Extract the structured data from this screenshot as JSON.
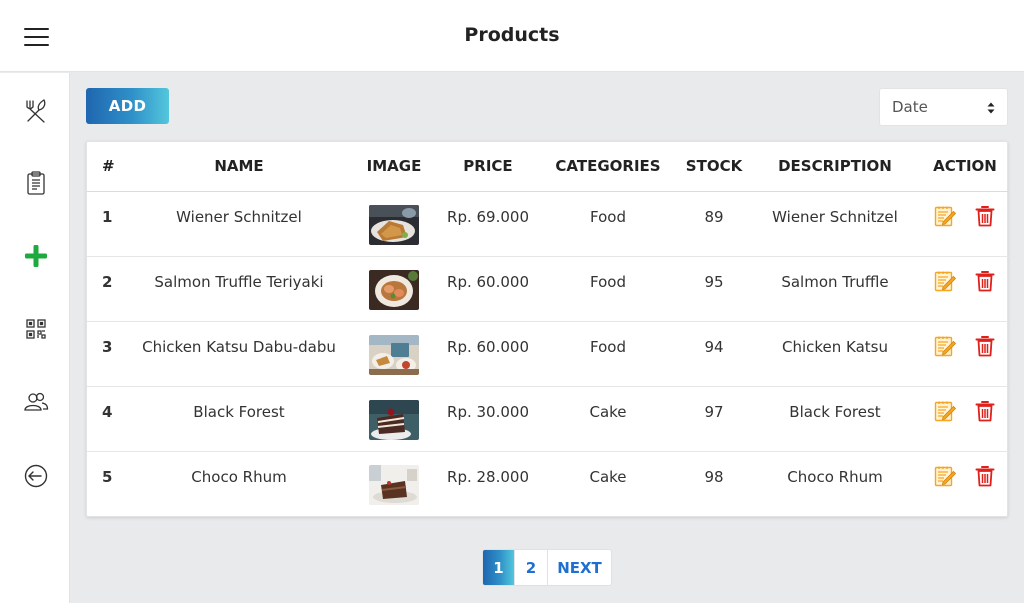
{
  "header": {
    "title": "Products"
  },
  "sidebar": {
    "items": [
      {
        "name": "food-menu-icon"
      },
      {
        "name": "clipboard-icon"
      },
      {
        "name": "add-icon",
        "color": "#1eaa3c"
      },
      {
        "name": "qr-code-icon"
      },
      {
        "name": "users-icon"
      },
      {
        "name": "logout-icon"
      }
    ]
  },
  "toolbar": {
    "add_label": "ADD",
    "sort_value": "Date"
  },
  "table": {
    "columns": [
      "#",
      "NAME",
      "IMAGE",
      "PRICE",
      "CATEGORIES",
      "STOCK",
      "DESCRIPTION",
      "ACTION"
    ],
    "rows": [
      {
        "no": "1",
        "name": "Wiener Schnitzel",
        "price": "Rp. 69.000",
        "category": "Food",
        "stock": "89",
        "description": "Wiener Schnitzel"
      },
      {
        "no": "2",
        "name": "Salmon Truffle Teriyaki",
        "price": "Rp. 60.000",
        "category": "Food",
        "stock": "95",
        "description": "Salmon Truffle"
      },
      {
        "no": "3",
        "name": "Chicken Katsu Dabu-dabu",
        "price": "Rp. 60.000",
        "category": "Food",
        "stock": "94",
        "description": "Chicken Katsu"
      },
      {
        "no": "4",
        "name": "Black Forest",
        "price": "Rp. 30.000",
        "category": "Cake",
        "stock": "97",
        "description": "Black Forest"
      },
      {
        "no": "5",
        "name": "Choco Rhum",
        "price": "Rp. 28.000",
        "category": "Cake",
        "stock": "98",
        "description": "Choco Rhum"
      }
    ]
  },
  "pagination": {
    "pages": [
      "1",
      "2"
    ],
    "current": "1",
    "next_label": "NEXT"
  },
  "colors": {
    "accent_start": "#1f66b0",
    "accent_end": "#53c6dc",
    "edit": "#f5a623",
    "delete": "#e0201b",
    "link": "#1f6fd1"
  }
}
